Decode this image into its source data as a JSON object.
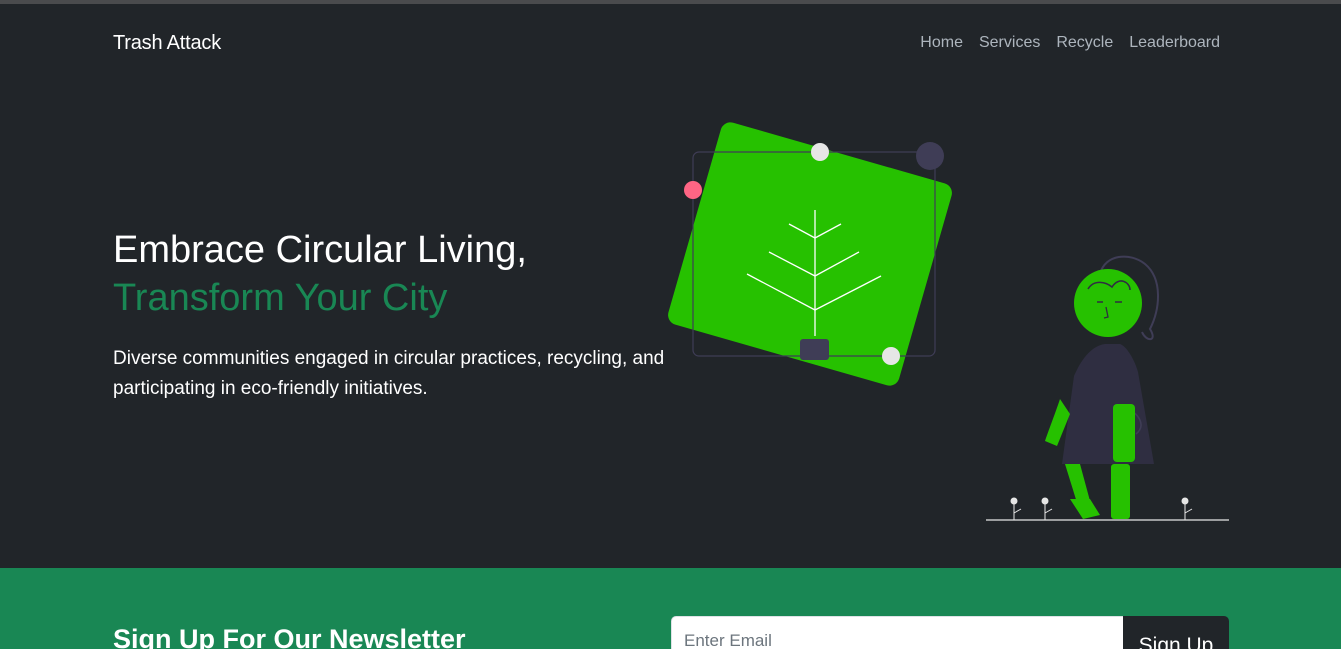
{
  "brand": "Trash Attack",
  "nav": [
    "Home",
    "Services",
    "Recycle",
    "Leaderboard"
  ],
  "hero": {
    "title_line1": "Embrace Circular Living,",
    "title_line2": "Transform Your City",
    "description": "Diverse communities engaged in circular practices, recycling, and participating in eco-friendly initiatives."
  },
  "newsletter": {
    "title": "Sign Up For Our Newsletter",
    "email_placeholder": "Enter Email",
    "button_label": "Sign Up"
  },
  "colors": {
    "background": "#212529",
    "accent_green": "#198754",
    "illustration_green": "#26c100",
    "nav_text": "#adb5bd"
  }
}
